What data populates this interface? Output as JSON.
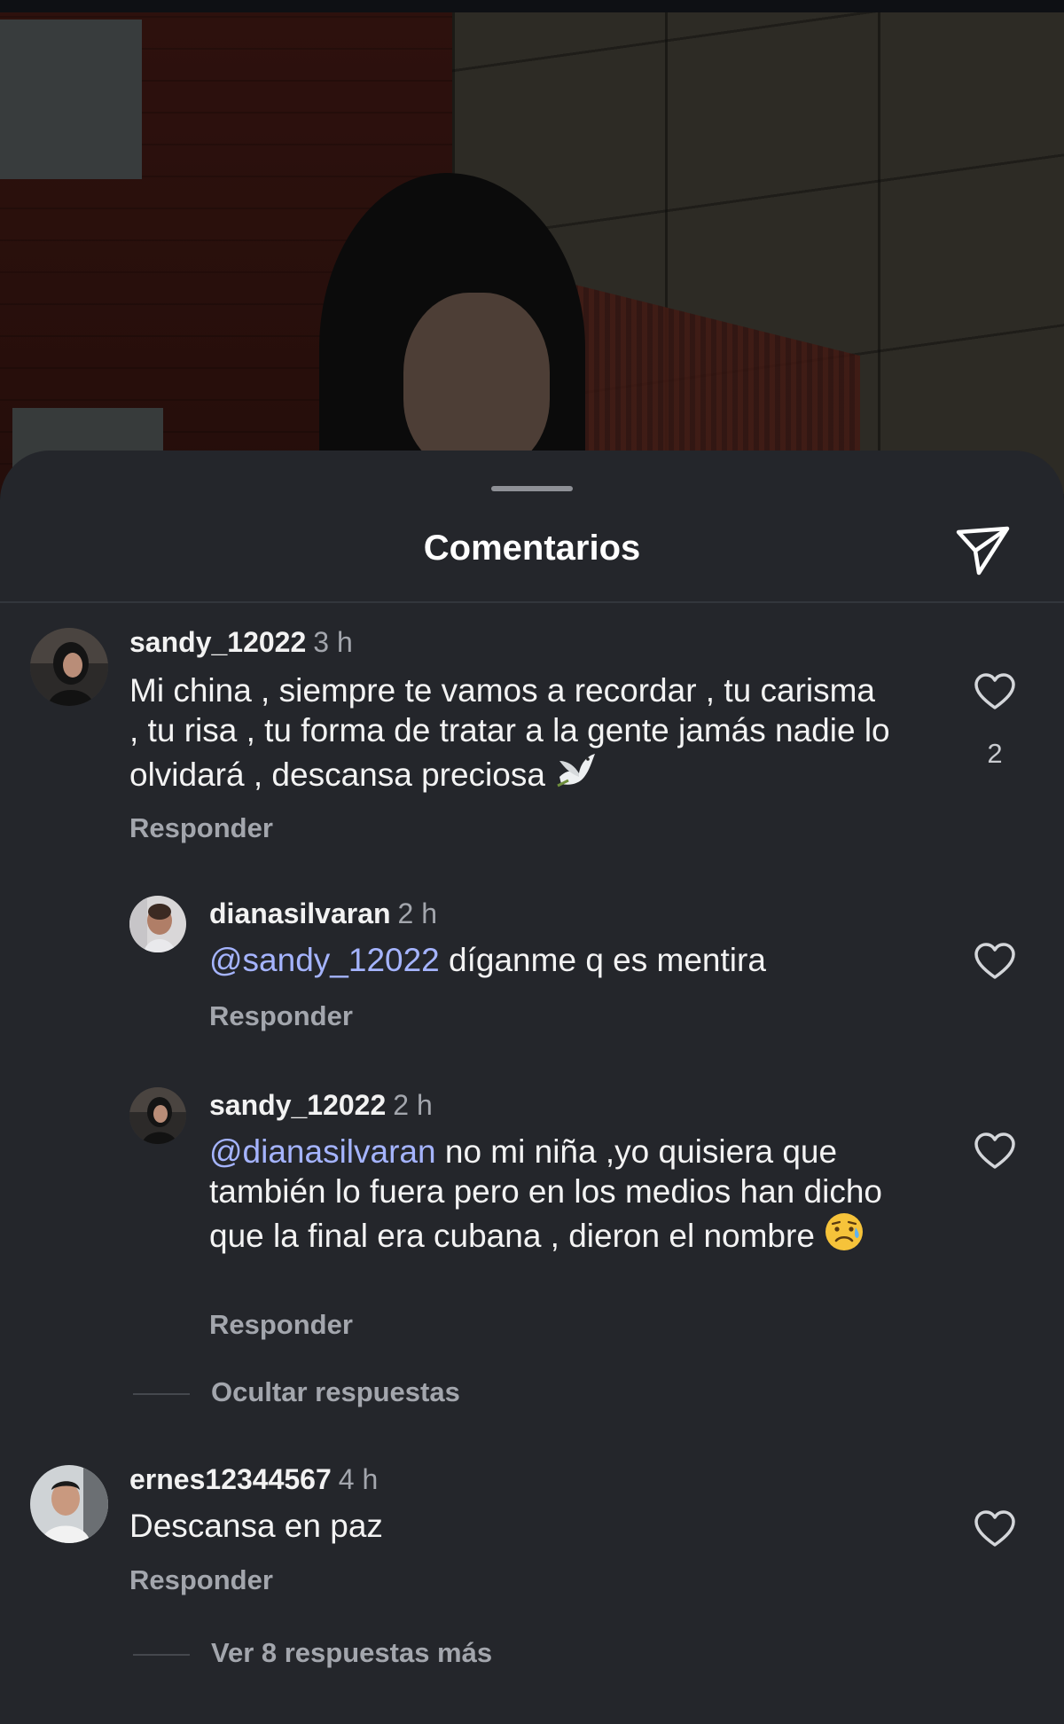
{
  "sheet": {
    "title": "Comentarios",
    "share_icon": "send-icon"
  },
  "comments": [
    {
      "username": "sandy_12022",
      "time": "3 h",
      "text": "Mi china , siempre te vamos a recordar , tu carisma , tu risa , tu forma de tratar a la gente jamás nadie lo olvidará , descansa preciosa",
      "emoji": "dove-emoji",
      "reply_label": "Responder",
      "like_count": "2",
      "replies": [
        {
          "username": "dianasilvaran",
          "time": "2 h",
          "mention": "@sandy_12022",
          "text": "díganme q es mentira",
          "reply_label": "Responder"
        },
        {
          "username": "sandy_12022",
          "time": "2 h",
          "mention": "@dianasilvaran",
          "text": "no mi niña ,yo quisiera que también lo fuera pero en los medios han dicho que la final era cubana , dieron el nombre",
          "emoji": "sad-tear-emoji",
          "reply_label": "Responder"
        }
      ],
      "thread_toggle": "Ocultar respuestas"
    },
    {
      "username": "ernes12344567",
      "time": "4 h",
      "text": "Descansa en paz",
      "reply_label": "Responder",
      "thread_toggle": "Ver 8 respuestas más"
    }
  ],
  "colors": {
    "sheet_bg": "#24262b",
    "mention": "#a5b4ff",
    "secondary_text": "#a3a6ad"
  }
}
